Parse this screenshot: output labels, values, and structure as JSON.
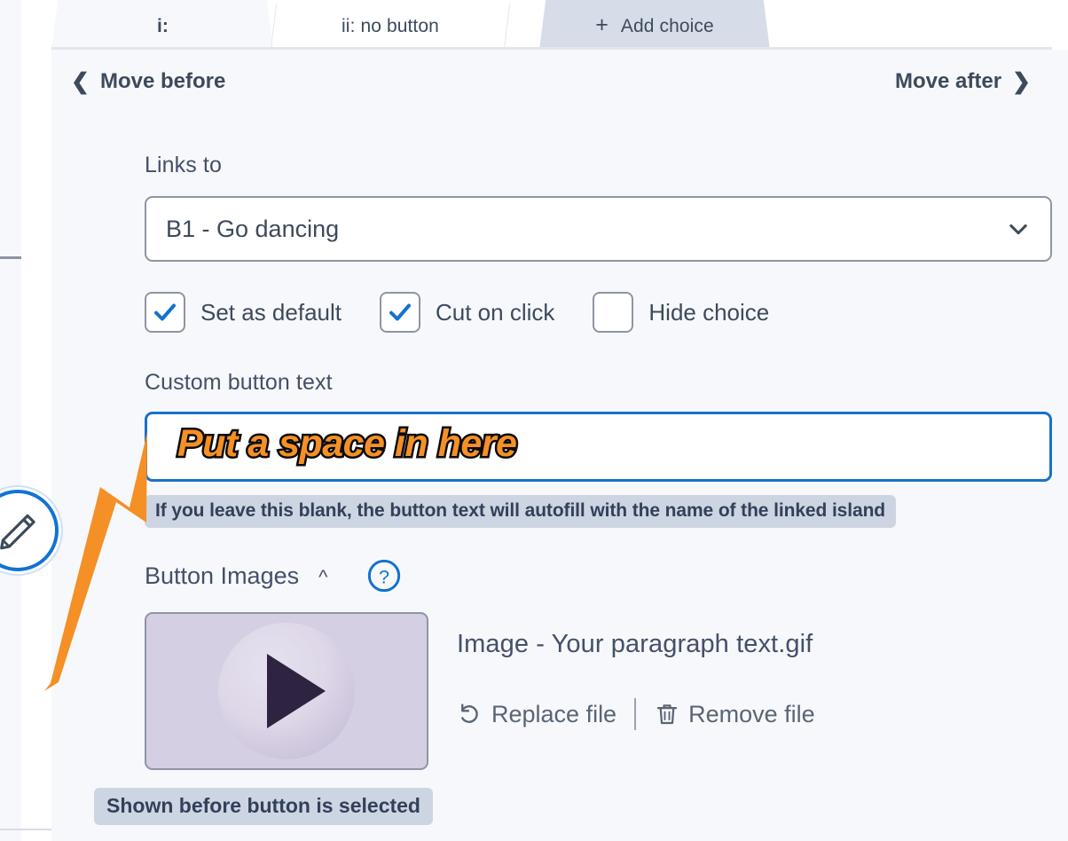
{
  "tabs": [
    {
      "label": "i:",
      "state": "active"
    },
    {
      "label": "ii: no button",
      "state": "inactive"
    },
    {
      "label": "Add choice",
      "state": "add",
      "icon": "plus-icon"
    }
  ],
  "move_row": {
    "before_label": "Move before",
    "after_label": "Move after",
    "before_icon": "chevron-left-icon",
    "after_icon": "chevron-right-icon"
  },
  "links_to": {
    "label": "Links to",
    "value": "B1 - Go dancing",
    "caret_icon": "chevron-down-icon"
  },
  "checkboxes": [
    {
      "label": "Set as default",
      "checked": true
    },
    {
      "label": "Cut on click",
      "checked": true
    },
    {
      "label": "Hide choice",
      "checked": false
    }
  ],
  "custom_button_text": {
    "label": "Custom button text",
    "value": "",
    "placeholder": "",
    "focused": true,
    "hint": "If you leave this blank, the button text will autofill with the name of the linked island"
  },
  "button_images": {
    "title": "Button Images",
    "collapse_icon": "chevron-up-icon",
    "help_icon": "question-mark-circle-icon",
    "thumbnail_icon": "play-icon",
    "file_name": "Image - Your paragraph text.gif",
    "replace_label": "Replace file",
    "replace_icon": "undo-icon",
    "remove_label": "Remove file",
    "remove_icon": "trash-icon",
    "status_badge": "Shown before button is selected"
  },
  "annotation": {
    "text": "Put a space in here",
    "arrow_icon": "arrow-up-right-icon",
    "color": "#f59026",
    "outline_color": "#0b0b0b"
  },
  "edit_badge": {
    "icon": "pencil-icon",
    "ring_color": "#1173d4"
  },
  "colors": {
    "panel_bg": "#f7f8fb",
    "accent_blue": "#1872c8",
    "text": "#3d4a5c",
    "badge_bg": "#ced5e2",
    "thumb_bg": "#d5cfe3",
    "tab_add_bg": "#d7dde8"
  }
}
